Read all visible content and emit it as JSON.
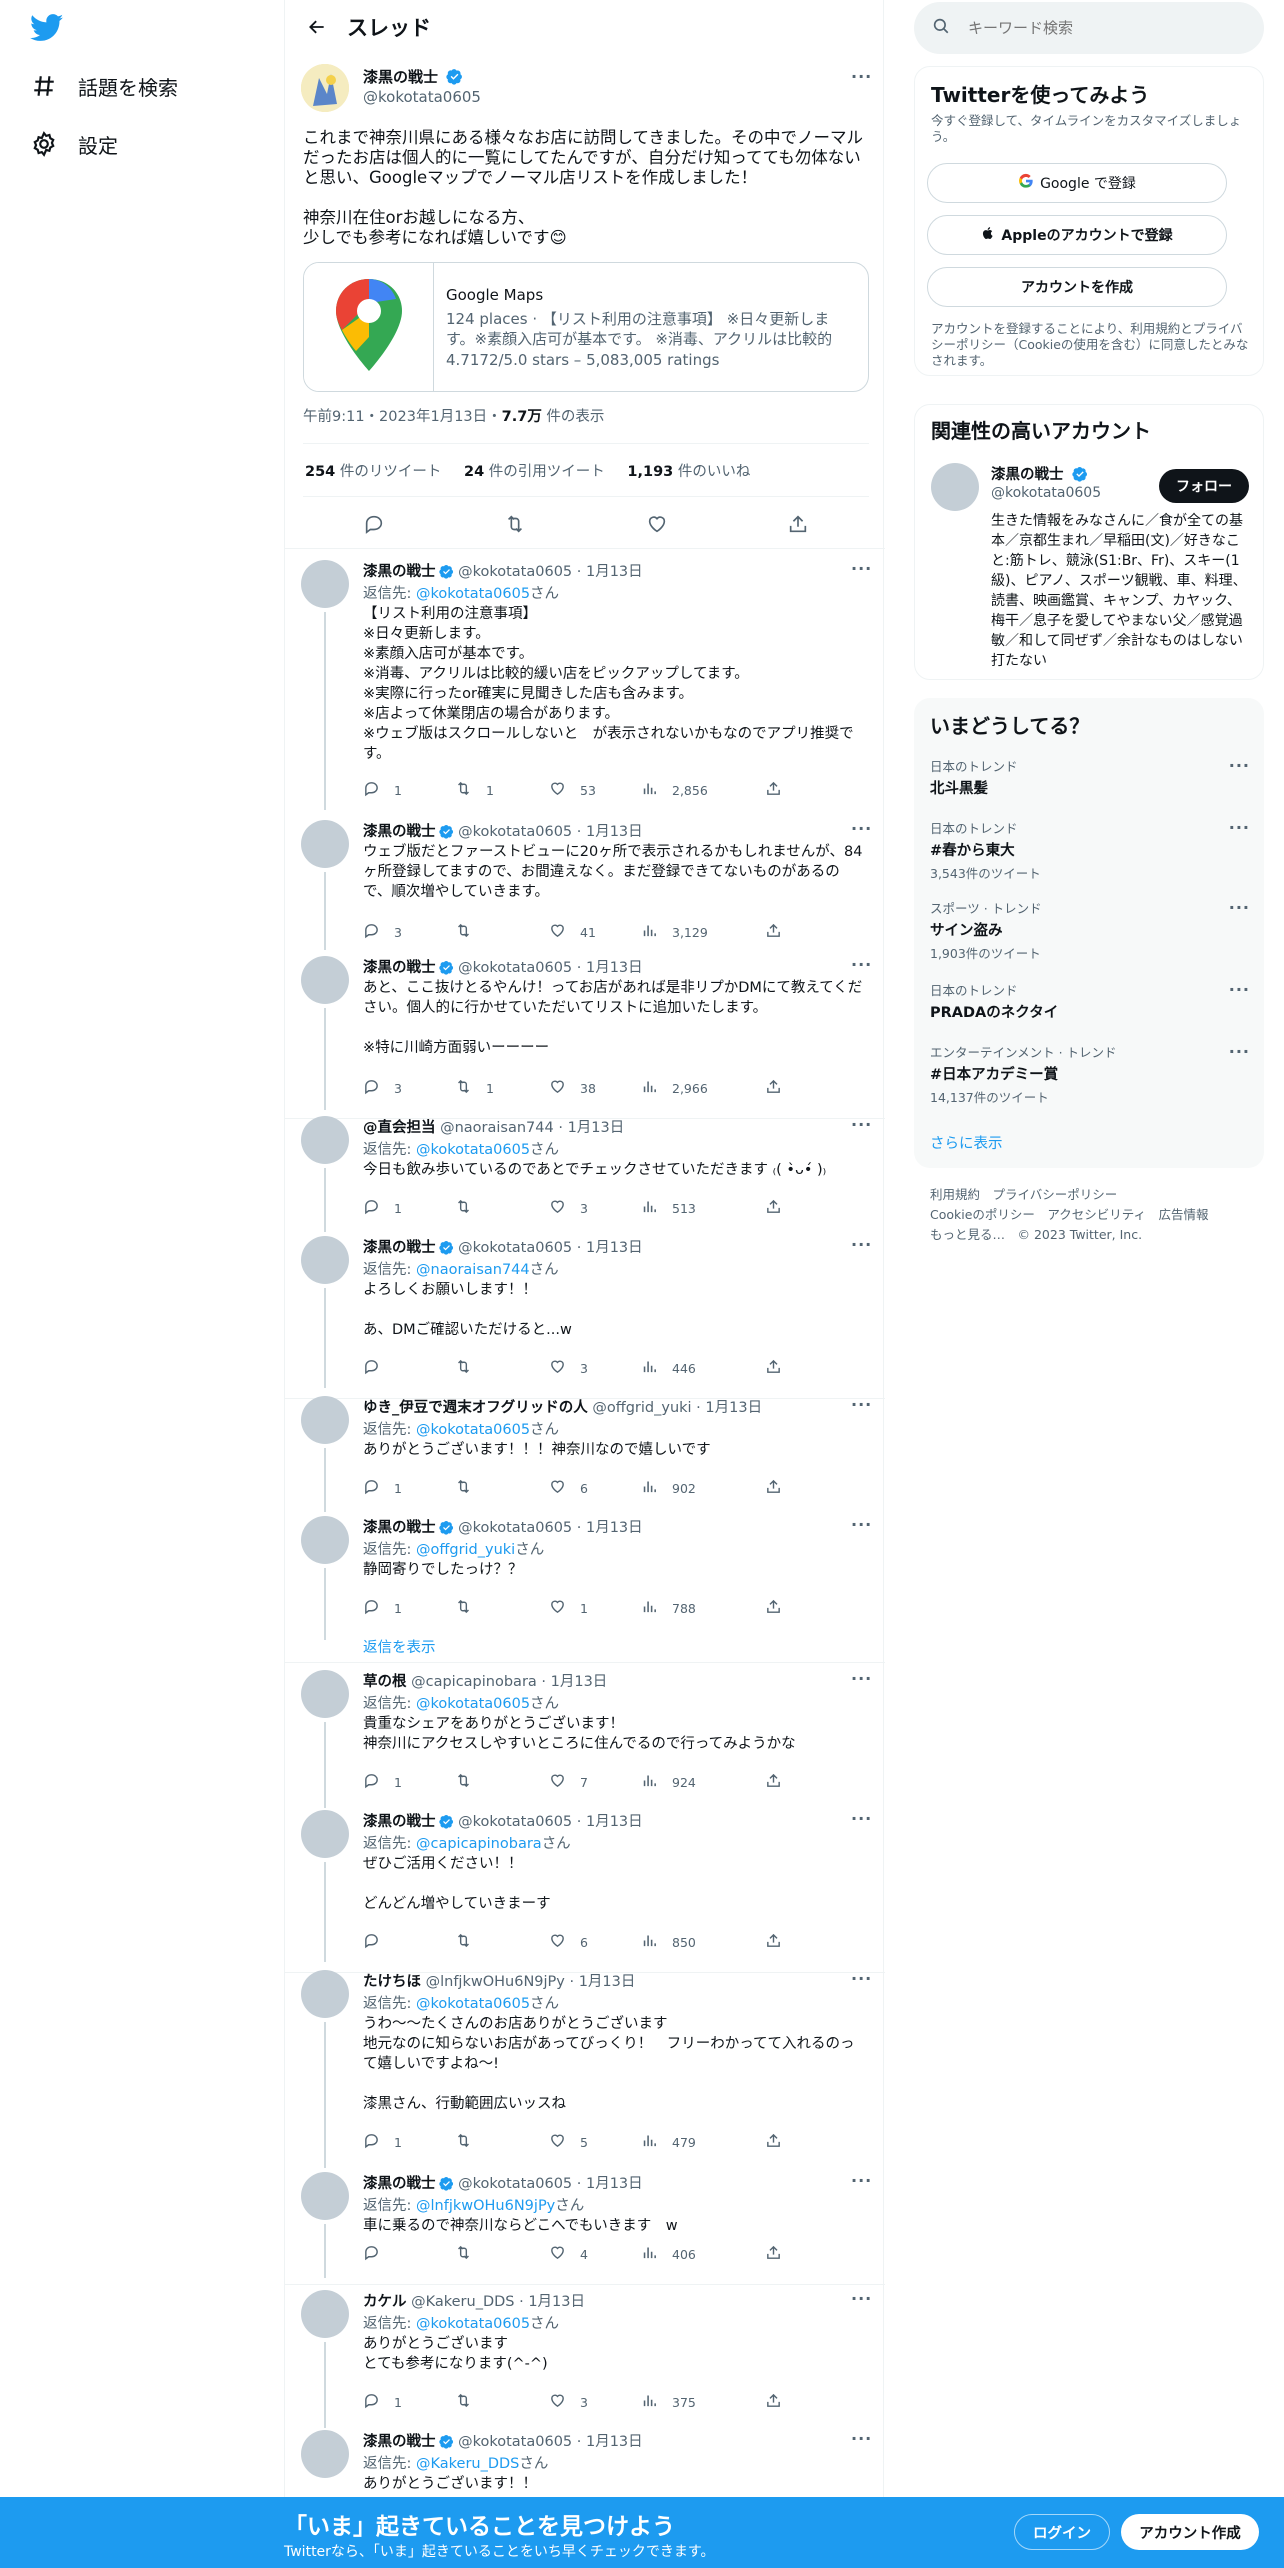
{
  "nav": {
    "explore_label": "話題を検索",
    "settings_label": "設定"
  },
  "header": {
    "title": "スレッド"
  },
  "main_tweet": {
    "name": "漆黒の戦士",
    "handle": "@kokotata0605",
    "text": "これまで神奈川県にある様々なお店に訪問してきました。その中でノーマルだったお店は個人的に一覧にしてたんですが、自分だけ知ってても勿体ないと思い、Googleマップでノーマル店リストを作成しました！\n\n神奈川在住orお越しになる方、\n少しでも参考になれば嬉しいです😊",
    "card": {
      "domain": "Google Maps",
      "description": "124 places · 【リスト利用の注意事項】 ※日々更新します。※素顔入店可が基本です。 ※消毒、アクリルは比較的緩...",
      "rating": "4.7172/5.0 stars – 5,083,005 ratings"
    },
    "time": "午前9:11・2023年1月13日・",
    "views_count": "7.7万",
    "views_label": " 件の表示",
    "retweets_count": "254",
    "retweets_label": " 件のリツイート",
    "quotes_count": "24",
    "quotes_label": " 件の引用ツイート",
    "likes_count": "1,193",
    "likes_label": " 件のいいね"
  },
  "replies": [
    {
      "name": "漆黒の戦士",
      "verified": true,
      "handle": "@kokotata0605 · 1月13日",
      "reply_to": "@kokotata0605",
      "text": "【リスト利用の注意事項】\n※日々更新します。\n※素顔入店可が基本です。\n※消毒、アクリルは比較的緩い店をピックアップしてます。\n※実際に行ったor確実に見聞きした店も含みます。\n※店よって休業閉店の場合があります。\n※ウェブ版はスクロールしないと　が表示されないかもなのでアプリ推奨です。",
      "replies": "1",
      "retweets": "1",
      "likes": "53",
      "views": "2,856"
    },
    {
      "name": "漆黒の戦士",
      "verified": true,
      "handle": "@kokotata0605 · 1月13日",
      "reply_to": "",
      "text": "ウェブ版だとファーストビューに20ヶ所で表示されるかもしれませんが、84ヶ所登録してますので、お間違えなく。まだ登録できてないものがあるので、順次増やしていきます。",
      "replies": "3",
      "retweets": "",
      "likes": "41",
      "views": "3,129"
    },
    {
      "name": "漆黒の戦士",
      "verified": true,
      "handle": "@kokotata0605 · 1月13日",
      "reply_to": "",
      "text": "あと、ここ抜けとるやんけ！ってお店があれば是非リプかDMにて教えてください。個人的に行かせていただいてリストに追加いたします。\n\n※特に川崎方面弱いーーーー",
      "replies": "3",
      "retweets": "1",
      "likes": "38",
      "views": "2,966"
    },
    {
      "name": "@直会担当",
      "verified": false,
      "handle": "@naoraisan744 · 1月13日",
      "reply_to": "@kokotata0605",
      "text": "今日も飲み歩いているのであとでチェックさせていただきます ₍( •̀ᴗ•́ )₎",
      "replies": "1",
      "retweets": "",
      "likes": "3",
      "views": "513"
    },
    {
      "name": "漆黒の戦士",
      "verified": true,
      "handle": "@kokotata0605 · 1月13日",
      "reply_to": "@naoraisan744",
      "text": "よろしくお願いします！！\n\nあ、DMご確認いただけると...w",
      "replies": "",
      "retweets": "",
      "likes": "3",
      "views": "446"
    },
    {
      "name": "ゆき_伊豆で週末オフグリッドの人",
      "verified": false,
      "handle": "@offgrid_yuki · 1月13日",
      "reply_to": "@kokotata0605",
      "text": "ありがとうございます！！！神奈川なので嬉しいです",
      "replies": "1",
      "retweets": "",
      "likes": "6",
      "views": "902"
    },
    {
      "name": "漆黒の戦士",
      "verified": true,
      "handle": "@kokotata0605 · 1月13日",
      "reply_to": "@offgrid_yuki",
      "text": "静岡寄りでしたっけ？？",
      "replies": "1",
      "retweets": "",
      "likes": "1",
      "views": "788"
    },
    {
      "name": "草の根",
      "verified": false,
      "handle": "@capicapinobara · 1月13日",
      "reply_to": "@kokotata0605",
      "text": "貴重なシェアをありがとうございます！\n神奈川にアクセスしやすいところに住んでるので行ってみようかな",
      "replies": "1",
      "retweets": "",
      "likes": "7",
      "views": "924"
    },
    {
      "name": "漆黒の戦士",
      "verified": true,
      "handle": "@kokotata0605 · 1月13日",
      "reply_to": "@capicapinobara",
      "text": "ぜひご活用ください！！\n\nどんどん増やしていきまーす",
      "replies": "",
      "retweets": "",
      "likes": "6",
      "views": "850"
    },
    {
      "name": "たけちほ",
      "verified": false,
      "handle": "@lnfjkwOHu6N9jPy · 1月13日",
      "reply_to": "@kokotata0605",
      "text": "うわ～～たくさんのお店ありがとうございます\n地元なのに知らないお店があってびっくり！　フリーわかってて入れるのって嬉しいですよね〜!\n\n漆黒さん、行動範囲広いッスね",
      "replies": "1",
      "retweets": "",
      "likes": "5",
      "views": "479"
    },
    {
      "name": "漆黒の戦士",
      "verified": true,
      "handle": "@kokotata0605 · 1月13日",
      "reply_to": "@lnfjkwOHu6N9jPy",
      "text": "車に乗るので神奈川ならどこへでもいきます　w",
      "replies": "",
      "retweets": "",
      "likes": "4",
      "views": "406"
    },
    {
      "name": "カケル",
      "verified": false,
      "handle": "@Kakeru_DDS · 1月13日",
      "reply_to": "@kokotata0605",
      "text": "ありがとうございます\nとても参考になります(^-^)",
      "replies": "1",
      "retweets": "",
      "likes": "3",
      "views": "375"
    },
    {
      "name": "漆黒の戦士",
      "verified": true,
      "handle": "@kokotata0605 · 1月13日",
      "reply_to": "@Kakeru_DDS",
      "text": "ありがとうございます！！",
      "replies": "",
      "retweets": "",
      "likes": "",
      "views": ""
    }
  ],
  "reply_to_prefix": "返信先: ",
  "reply_to_suffix": "さん",
  "show_replies": "返信を表示",
  "search": {
    "placeholder": "キーワード検索"
  },
  "signup": {
    "title": "Twitterを使ってみよう",
    "subtitle": "今すぐ登録して、タイムラインをカスタマイズしましょう。",
    "google": "Google で登録",
    "apple": "Appleのアカウントで登録",
    "create": "アカウントを作成",
    "terms": "アカウントを登録することにより、利用規約とプライバシーポリシー（Cookieの使用を含む）に同意したとみなされます。"
  },
  "related": {
    "title": "関連性の高いアカウント",
    "name": "漆黒の戦士",
    "handle": "@kokotata0605",
    "follow": "フォロー",
    "bio": "生きた情報をみなさんに／食が全ての基本／京都生まれ／早稲田(文)／好きなこと:筋トレ、競泳(S1:Br、Fr)、スキー(1級)、ピアノ、スポーツ観戦、車、料理、読書、映画鑑賞、キャンプ、カヤック、梅干／息子を愛してやまない父／感覚過敏／和して同ぜず／余計なものはしない打たない"
  },
  "trends": {
    "title": "いまどうしてる？",
    "items": [
      {
        "category": "日本のトレンド",
        "name": "北斗黒髪",
        "count": ""
      },
      {
        "category": "日本のトレンド",
        "name": "#春から東大",
        "count": "3,543件のツイート"
      },
      {
        "category": "スポーツ · トレンド",
        "name": "サイン盗み",
        "count": "1,903件のツイート"
      },
      {
        "category": "日本のトレンド",
        "name": "PRADAのネクタイ",
        "count": ""
      },
      {
        "category": "エンターテインメント · トレンド",
        "name": "#日本アカデミー賞",
        "count": "14,137件のツイート"
      }
    ],
    "more": "さらに表示"
  },
  "footer": {
    "line1": "利用規約　プライバシーポリシー",
    "line2": "Cookieのポリシー　アクセシビリティ　広告情報",
    "line3": "もっと見る…　© 2023 Twitter, Inc."
  },
  "bottom": {
    "title": "「いま」起きていることを見つけよう",
    "subtitle": "Twitterなら、「いま」起きていることをいち早くチェックできます。",
    "login": "ログイン",
    "signup": "アカウント作成"
  },
  "colors": {
    "accent": "#1d9bf0",
    "text": "#0f1419",
    "muted": "#536471",
    "border": "#eff3f4"
  }
}
